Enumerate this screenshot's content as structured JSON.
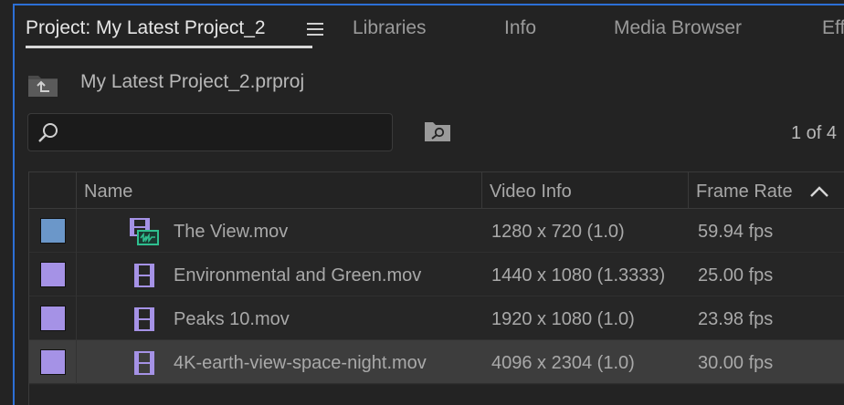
{
  "tabs": [
    {
      "label": "Project: My Latest Project_2",
      "active": true
    },
    {
      "label": "Libraries",
      "active": false
    },
    {
      "label": "Info",
      "active": false
    },
    {
      "label": "Media Browser",
      "active": false
    },
    {
      "label": "Eff",
      "active": false
    }
  ],
  "path": {
    "label": "My Latest Project_2.prproj"
  },
  "search": {
    "placeholder": "",
    "value": ""
  },
  "count": {
    "label": "1 of 4"
  },
  "table": {
    "headers": {
      "name": "Name",
      "video_info": "Video Info",
      "frame_rate": "Frame Rate"
    },
    "sort_direction": "ascending",
    "rows": [
      {
        "name": "The View.mov",
        "video_info": "1280 x 720 (1.0)",
        "frame_rate": "59.94 fps",
        "label_color": "#6b97c9",
        "icon": "video-audio-clip-icon",
        "selected": false
      },
      {
        "name": "Environmental and Green.mov",
        "video_info": "1440 x 1080 (1.3333)",
        "frame_rate": "25.00 fps",
        "label_color": "#a592e6",
        "icon": "video-clip-icon",
        "selected": false
      },
      {
        "name": "Peaks 10.mov",
        "video_info": "1920 x 1080 (1.0)",
        "frame_rate": "23.98 fps",
        "label_color": "#a592e6",
        "icon": "video-clip-icon",
        "selected": false
      },
      {
        "name": "4K-earth-view-space-night.mov",
        "video_info": "4096 x 2304 (1.0)",
        "frame_rate": "30.00 fps",
        "label_color": "#a592e6",
        "icon": "video-clip-icon",
        "selected": true
      }
    ]
  },
  "colors": {
    "accent": "#2c6fd6",
    "clip_icon_purple": "#a592e6",
    "audio_green": "#2fbf8f"
  }
}
